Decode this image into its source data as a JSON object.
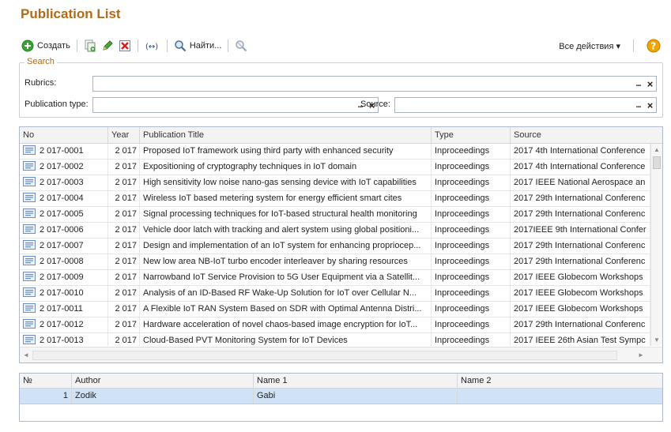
{
  "window": {
    "title": "Publication List"
  },
  "toolbar": {
    "create_label": "Создать",
    "find_label": "Найти...",
    "all_actions_label": "Все действия ▾",
    "help_label": "?"
  },
  "search": {
    "legend": "Search",
    "rubrics_label": "Rubrics:",
    "rubrics_value": "",
    "pubtype_label": "Publication type:",
    "pubtype_value": "",
    "source_label": "Source:",
    "source_value": "",
    "select_glyph": "...",
    "clear_glyph": "×"
  },
  "publications": {
    "columns": [
      "No",
      "Year",
      "Publication Title",
      "Type",
      "Source"
    ],
    "rows": [
      [
        "2 017-0001",
        "2 017",
        "Proposed IoT framework using third party with enhanced security",
        "Inproceedings",
        "2017 4th International Conference"
      ],
      [
        "2 017-0002",
        "2 017",
        "Expositioning of cryptography techniques in IoT domain",
        "Inproceedings",
        "2017 4th International Conference"
      ],
      [
        "2 017-0003",
        "2 017",
        "High sensitivity low noise nano-gas sensing device with IoT capabilities",
        "Inproceedings",
        "2017 IEEE National Aerospace an"
      ],
      [
        "2 017-0004",
        "2 017",
        "Wireless IoT based metering system for energy efficient smart cites",
        "Inproceedings",
        "2017 29th International Conferenc"
      ],
      [
        "2 017-0005",
        "2 017",
        "Signal processing techniques for IoT-based structural health monitoring",
        "Inproceedings",
        "2017 29th International Conferenc"
      ],
      [
        "2 017-0006",
        "2 017",
        "Vehicle door latch with tracking and alert system using global positioni...",
        "Inproceedings",
        "2017IEEE 9th International Confer"
      ],
      [
        "2 017-0007",
        "2 017",
        "Design and implementation of an IoT system for enhancing propriocep...",
        "Inproceedings",
        "2017 29th International Conferenc"
      ],
      [
        "2 017-0008",
        "2 017",
        "New low area NB-IoT turbo encoder interleaver by sharing resources",
        "Inproceedings",
        "2017 29th International Conferenc"
      ],
      [
        "2 017-0009",
        "2 017",
        "Narrowband IoT Service Provision to 5G User Equipment via a Satellit...",
        "Inproceedings",
        "2017 IEEE Globecom Workshops"
      ],
      [
        "2 017-0010",
        "2 017",
        "Analysis of an ID-Based RF Wake-Up Solution for IoT over Cellular N...",
        "Inproceedings",
        "2017 IEEE Globecom Workshops"
      ],
      [
        "2 017-0011",
        "2 017",
        "A Flexible IoT RAN System Based on SDR with Optimal Antenna Distri...",
        "Inproceedings",
        "2017 IEEE Globecom Workshops"
      ],
      [
        "2 017-0012",
        "2 017",
        "Hardware acceleration of novel chaos-based image encryption for IoT...",
        "Inproceedings",
        "2017 29th International Conferenc"
      ],
      [
        "2 017-0013",
        "2 017",
        "Cloud-Based PVT Monitoring System for IoT Devices",
        "Inproceedings",
        "2017 IEEE 26th Asian Test Sympc"
      ]
    ]
  },
  "authors": {
    "columns": [
      "№",
      "Author",
      "Name 1",
      "Name 2"
    ],
    "rows": [
      [
        "1",
        "Zodik",
        "Gabi",
        ""
      ]
    ]
  },
  "colors": {
    "title": "#b06a18",
    "selected_row": "#cfe2f6",
    "create_icon": "#3aa235",
    "delete_icon": "#d32020",
    "help_icon": "#f0a500"
  },
  "icons": {
    "create": "plus-circle-icon",
    "copy": "copy-icon",
    "edit": "pencil-icon",
    "delete": "delete-icon",
    "link": "link-icon",
    "find": "magnifier-icon",
    "cancel_search": "cancel-search-icon",
    "row": "document-icon",
    "help": "help-icon"
  }
}
